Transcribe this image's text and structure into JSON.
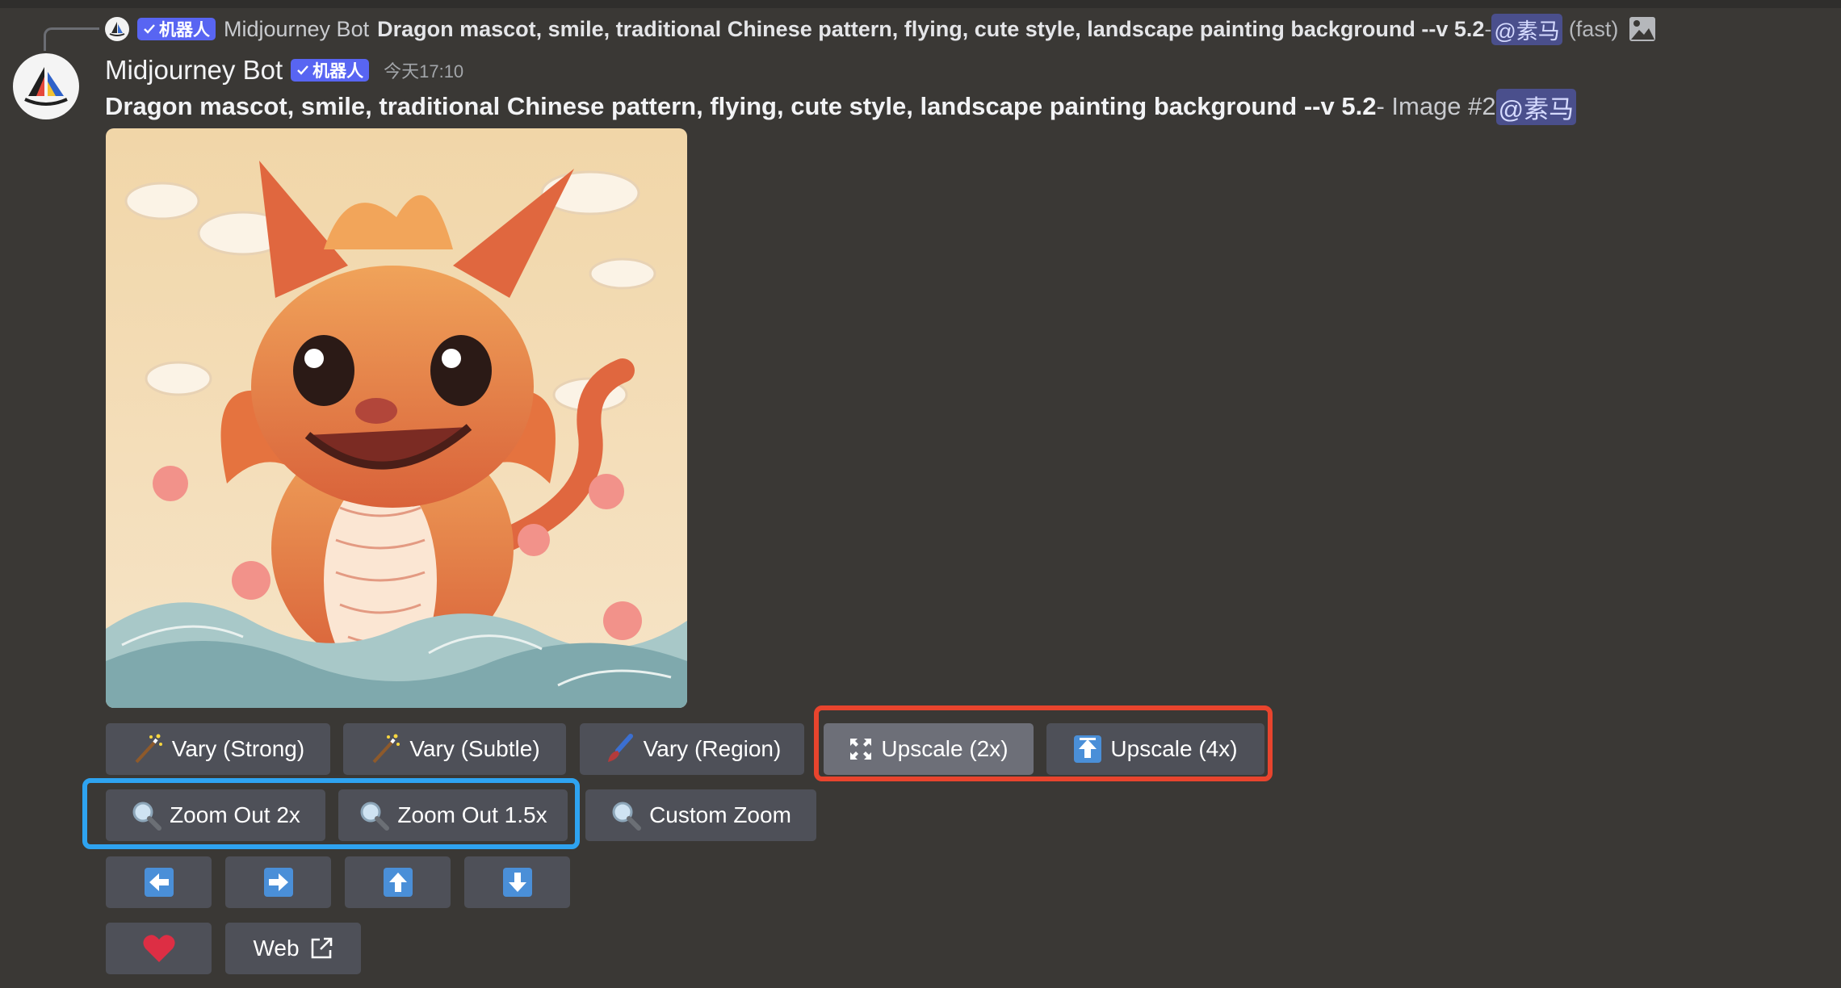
{
  "reply": {
    "badge": "机器人",
    "author": "Midjourney Bot",
    "prompt": "Dragon mascot, smile, traditional Chinese pattern, flying, cute style, landscape painting background --v 5.2",
    "separator": " - ",
    "mention": "@素马",
    "speed": "(fast)"
  },
  "message": {
    "author": "Midjourney Bot",
    "badge": "机器人",
    "timestamp": "今天17:10",
    "prompt": "Dragon mascot, smile, traditional Chinese pattern, flying, cute style, landscape painting background --v 5.2",
    "suffix": " - Image #2 ",
    "mention": "@素马"
  },
  "buttons": {
    "vary_strong": "Vary (Strong)",
    "vary_subtle": "Vary (Subtle)",
    "vary_region": "Vary (Region)",
    "upscale_2x": "Upscale (2x)",
    "upscale_4x": "Upscale (4x)",
    "zoom_out_2x": "Zoom Out 2x",
    "zoom_out_1_5x": "Zoom Out 1.5x",
    "custom_zoom": "Custom Zoom",
    "web": "Web"
  },
  "icons": {
    "wand": "magic-wand-icon",
    "brush": "paintbrush-icon",
    "upscale_2x": "expand-icon",
    "upscale_4x": "upload-arrow-icon",
    "zoom": "magnifier-icon",
    "pan_left": "arrow-left-icon",
    "pan_right": "arrow-right-icon",
    "pan_up": "arrow-up-icon",
    "pan_down": "arrow-down-icon",
    "favorite": "heart-icon",
    "external": "external-link-icon"
  },
  "colors": {
    "background": "#3a3835",
    "button": "#4e5058",
    "button_active": "#6d6f78",
    "badge": "#5865f2",
    "highlight_red": "#e8442d",
    "highlight_blue": "#2ea3f0",
    "arrow_tile": "#4a8fd8"
  }
}
